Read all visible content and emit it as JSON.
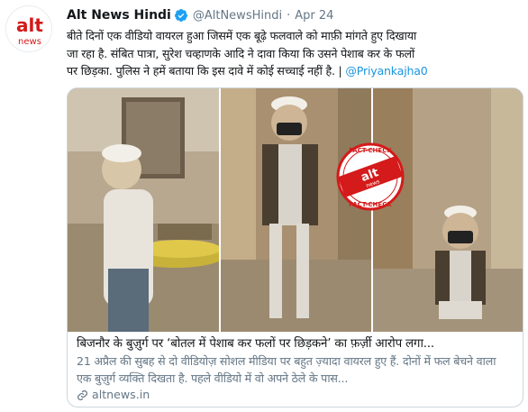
{
  "avatar": {
    "logo_text_top": "alt",
    "logo_text_bottom": "news",
    "brand_color": "#d41a1a"
  },
  "tweet": {
    "display_name": "Alt News Hindi",
    "handle": "@AltNewsHindi",
    "separator": "·",
    "date": "Apr 24",
    "verified_color": "#1da1f2",
    "body_line_1": "बीते दिनों एक वीडियो वायरल हुआ जिसमें एक बूढ़े फलवाले को माफ़ी मांगते हुए दिखाया",
    "body_line_2": "जा रहा है. संबित पात्रा, सुरेश चव्हाणके आदि ने दावा किया कि उसने पेशाब कर के फलों",
    "body_line_3_text": "पर छिड़का. पुलिस ने हमें बताया कि इस दावे में कोई सच्चाई नहीं है. | ",
    "body_mention": "@Priyankajha0",
    "link_color": "#1b95e0"
  },
  "card": {
    "stamp_top": "FACT-CHECK",
    "stamp_bottom": "FACT-CHECK",
    "stamp_logo": "alt",
    "stamp_logo_bottom": "news",
    "title": "बिजनौर के बुज़ुर्ग पर ‘बोतल में पेशाब कर फलों पर छिड़कने’ का फ़र्ज़ी आरोप लगा...",
    "description": "21 अप्रैल की सुबह से दो वीडियोज़ सोशल मीडिया पर बहुत ज़्यादा वायरल हुए हैं. दोनों में फल बेचने वाला एक बुज़ुर्ग व्यक्ति दिखता है. पहले वीडियो में वो अपने ठेले के पास...",
    "domain": "altnews.in",
    "icons": [
      "link-icon",
      "verified-badge-icon"
    ]
  }
}
